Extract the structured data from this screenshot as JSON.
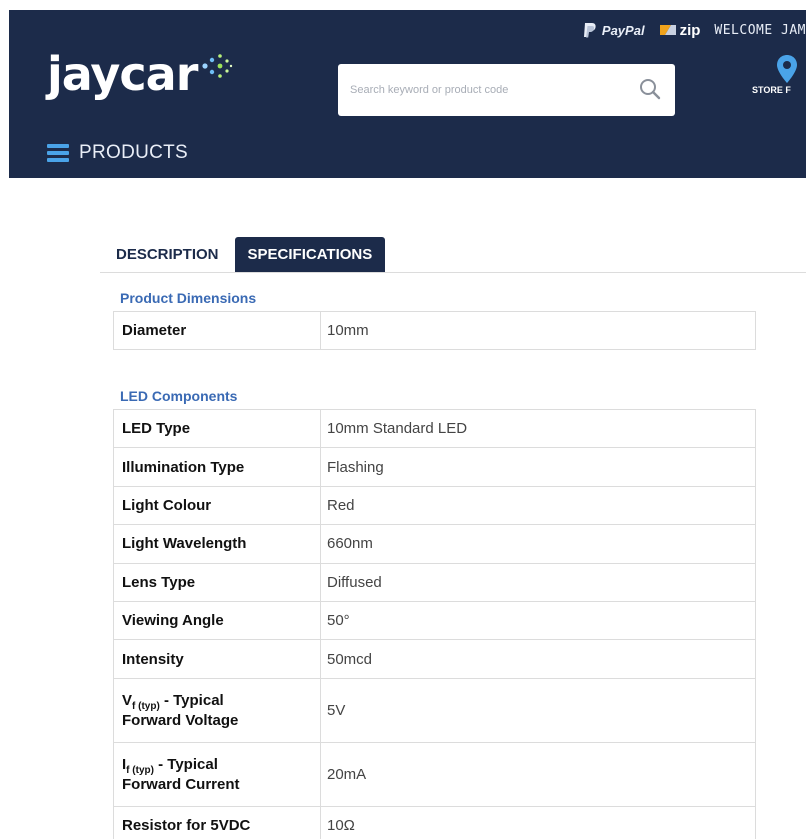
{
  "header": {
    "paypal_label": "PayPal",
    "zip_label": "zip",
    "welcome_text": "WELCOME JAM",
    "logo_text": "jaycar",
    "search_placeholder": "Search keyword or product code",
    "store_label": "STORE F",
    "products_label": "PRODUCTS",
    "colors": {
      "navy": "#1c2b4a",
      "accent_blue": "#4aa3e8",
      "title_blue": "#3a6ab4"
    }
  },
  "tabs": [
    {
      "label": "DESCRIPTION",
      "active": false
    },
    {
      "label": "SPECIFICATIONS",
      "active": true
    }
  ],
  "sections": [
    {
      "title": "Product Dimensions",
      "rows": [
        {
          "key": "Diameter",
          "value": "10mm"
        }
      ]
    },
    {
      "title": "LED Components",
      "rows": [
        {
          "key": "LED Type",
          "value": "10mm Standard LED"
        },
        {
          "key": "Illumination Type",
          "value": "Flashing"
        },
        {
          "key": "Light Colour",
          "value": "Red"
        },
        {
          "key": "Light Wavelength",
          "value": "660nm"
        },
        {
          "key": "Lens Type",
          "value": "Diffused"
        },
        {
          "key": "Viewing Angle",
          "value": "50°"
        },
        {
          "key": "Intensity",
          "value": "50mcd"
        },
        {
          "key_main": "V",
          "key_sub": "f (typ)",
          "key_rest": " - Typical",
          "key_line2": "Forward Voltage",
          "value": "5V"
        },
        {
          "key_main": "I",
          "key_sub": "f (typ)",
          "key_rest": " - Typical",
          "key_line2": "Forward Current",
          "value": "20mA"
        },
        {
          "key": "Resistor for 5VDC",
          "value": "10Ω"
        }
      ]
    }
  ]
}
